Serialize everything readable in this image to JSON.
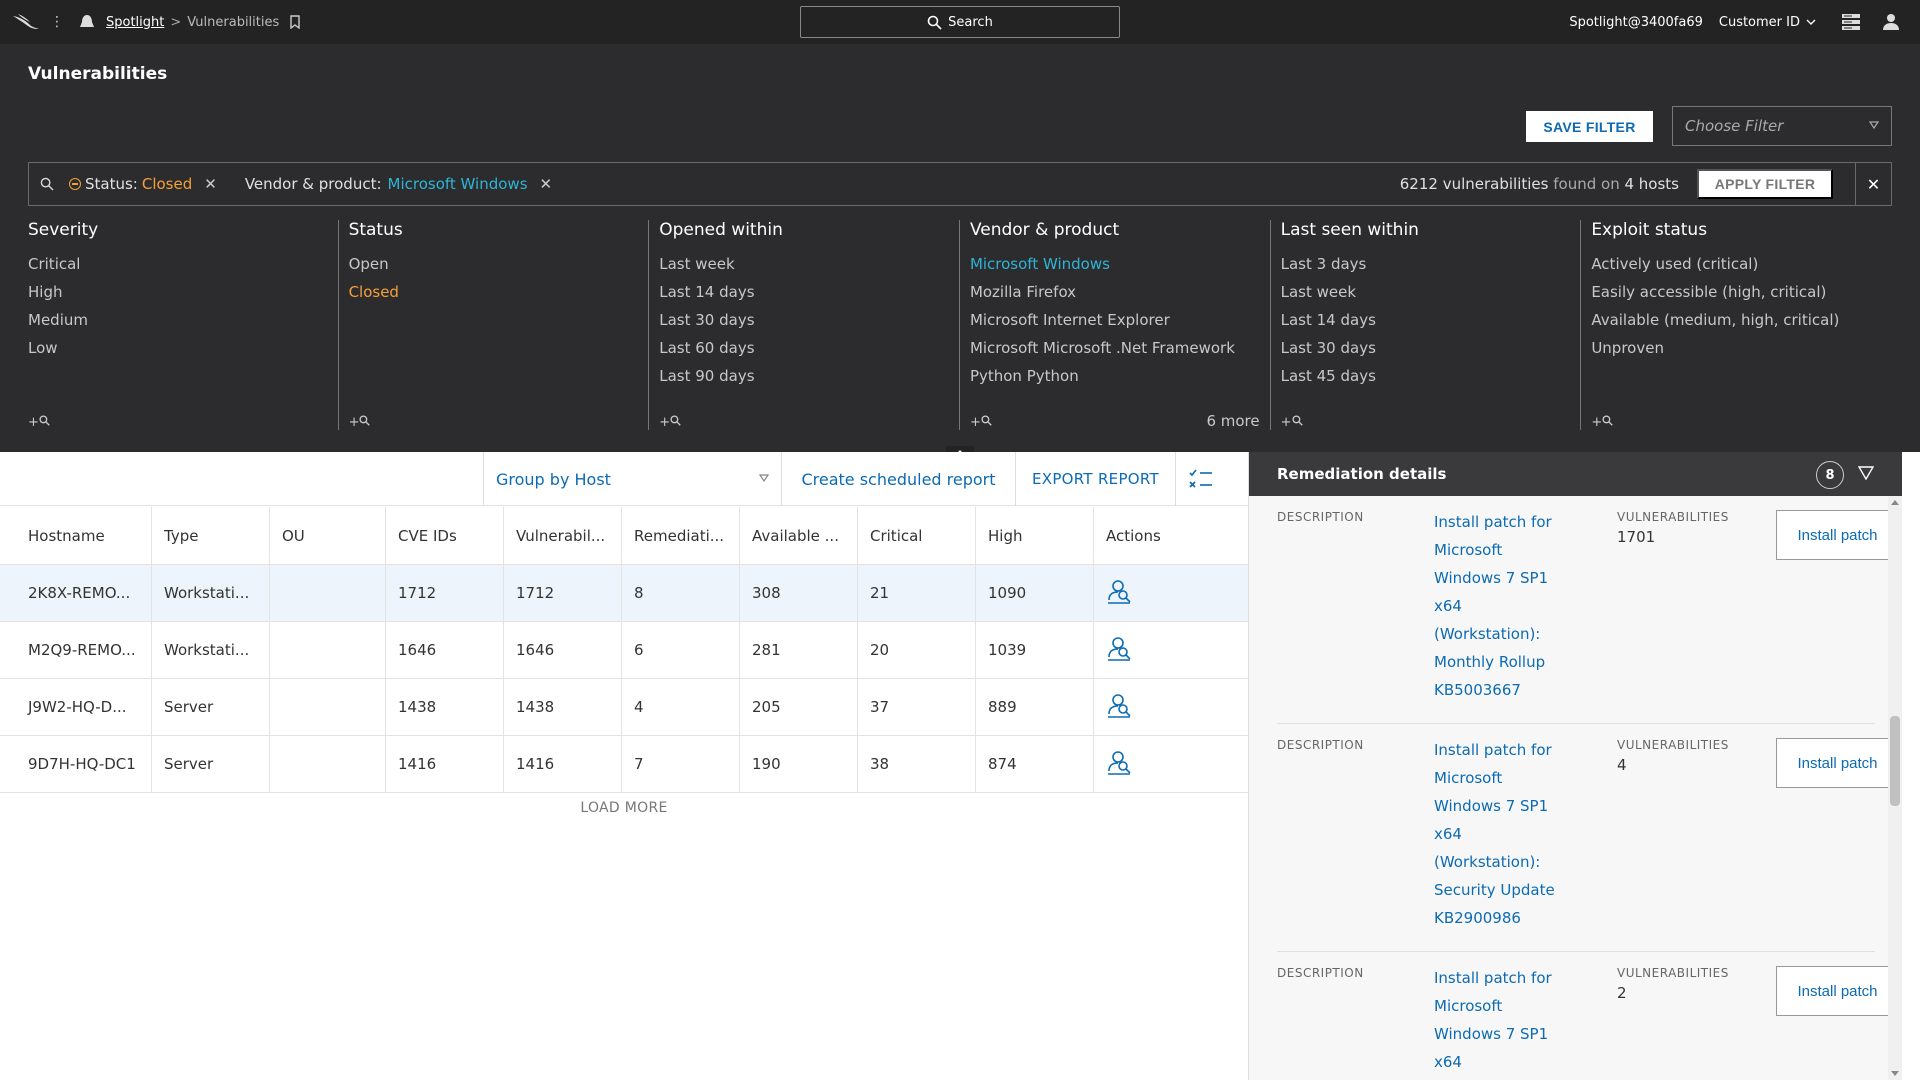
{
  "topbar": {
    "breadcrumb_app": "Spotlight",
    "breadcrumb_sep": ">",
    "breadcrumb_current": "Vulnerabilities",
    "search_label": "Search",
    "user": "Spotlight@3400fa69",
    "customer": "Customer ID"
  },
  "page": {
    "title": "Vulnerabilities"
  },
  "filter": {
    "save_label": "SAVE FILTER",
    "choose_placeholder": "Choose Filter",
    "chips": [
      {
        "key": "Status:",
        "value": "Closed"
      },
      {
        "key": "Vendor & product:",
        "value": "Microsoft Windows"
      }
    ],
    "found_count": "6212 vulnerabilities",
    "found_mid": "found on",
    "found_hosts": "4 hosts",
    "apply_label": "APPLY FILTER",
    "clear_icon": "close-icon"
  },
  "filter_columns": [
    {
      "title": "Severity",
      "options": [
        "Critical",
        "High",
        "Medium",
        "Low"
      ],
      "selected": ""
    },
    {
      "title": "Status",
      "options": [
        "Open",
        "Closed"
      ],
      "selected": "Closed"
    },
    {
      "title": "Opened within",
      "options": [
        "Last week",
        "Last 14 days",
        "Last 30 days",
        "Last 60 days",
        "Last 90 days"
      ],
      "selected": ""
    },
    {
      "title": "Vendor & product",
      "options": [
        "Microsoft Windows",
        "Mozilla Firefox",
        "Microsoft Internet Explorer",
        "Microsoft Microsoft .Net Framework",
        "Python Python"
      ],
      "selected": "Microsoft Windows",
      "more": "6 more"
    },
    {
      "title": "Last seen within",
      "options": [
        "Last 3 days",
        "Last week",
        "Last 14 days",
        "Last 30 days",
        "Last 45 days"
      ],
      "selected": ""
    },
    {
      "title": "Exploit status",
      "options": [
        "Actively used (critical)",
        "Easily accessible (high, critical)",
        "Available (medium, high, critical)",
        "Unproven"
      ],
      "selected": ""
    }
  ],
  "filter_plus": "+",
  "toolbar": {
    "group_by": "Group by Host",
    "scheduled": "Create scheduled report",
    "export": "EXPORT REPORT"
  },
  "table": {
    "headers": [
      "Hostname",
      "Type",
      "OU",
      "CVE IDs",
      "Vulnerabil...",
      "Remediati...",
      "Available ...",
      "Critical",
      "High",
      "Actions"
    ],
    "rows": [
      [
        "2K8X-REMO...",
        "Workstati...",
        "",
        "1712",
        "1712",
        "8",
        "308",
        "21",
        "1090"
      ],
      [
        "M2Q9-REMO...",
        "Workstati...",
        "",
        "1646",
        "1646",
        "6",
        "281",
        "20",
        "1039"
      ],
      [
        "J9W2-HQ-D...",
        "Server",
        "",
        "1438",
        "1438",
        "4",
        "205",
        "37",
        "889"
      ],
      [
        "9D7H-HQ-DC1",
        "Server",
        "",
        "1416",
        "1416",
        "7",
        "190",
        "38",
        "874"
      ]
    ],
    "load_more": "LOAD MORE"
  },
  "remediation": {
    "title": "Remediation details",
    "count": "8",
    "desc_label": "DESCRIPTION",
    "vuln_label": "VULNERABILITIES",
    "button_label": "Install patch",
    "items": [
      {
        "lines": [
          "Install patch for",
          "Microsoft",
          "Windows 7 SP1",
          "x64",
          "(Workstation):",
          "Monthly Rollup",
          "KB5003667"
        ],
        "vulns": "1701"
      },
      {
        "lines": [
          "Install patch for",
          "Microsoft",
          "Windows 7 SP1",
          "x64",
          "(Workstation):",
          "Security Update",
          "KB2900986"
        ],
        "vulns": "4"
      },
      {
        "lines": [
          "Install patch for",
          "Microsoft",
          "Windows 7 SP1",
          "x64"
        ],
        "vulns": "2"
      }
    ]
  },
  "colors": {
    "accent": "#0c6bb3",
    "orange": "#f4a13a",
    "cyan": "#2eb5d6",
    "dark": "#2c2b2d"
  }
}
